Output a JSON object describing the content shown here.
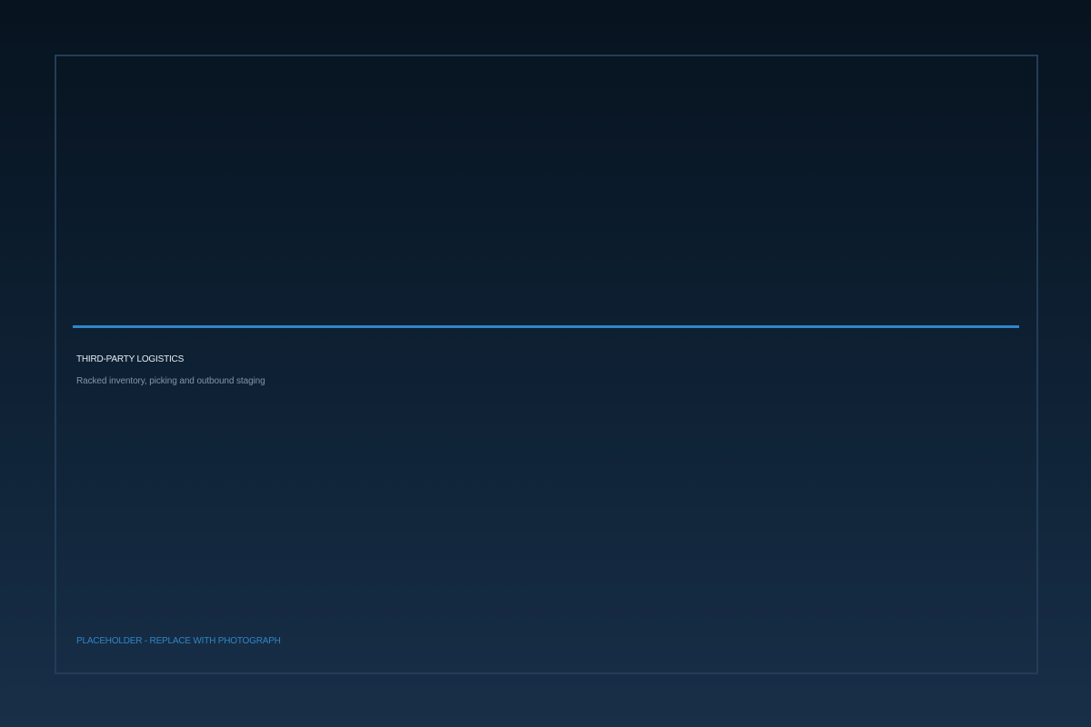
{
  "card": {
    "title": "THIRD-PARTY LOGISTICS",
    "subtitle": "Racked inventory, picking and outbound staging",
    "placeholder_note": "PLACEHOLDER - REPLACE WITH PHOTOGRAPH"
  },
  "colors": {
    "accent": "#2f86c9",
    "frame_border": "#233d58",
    "background_top": "#07131f",
    "background_bottom": "#182f48",
    "title_text": "#e6edf4",
    "subtitle_text": "#8194a8"
  }
}
